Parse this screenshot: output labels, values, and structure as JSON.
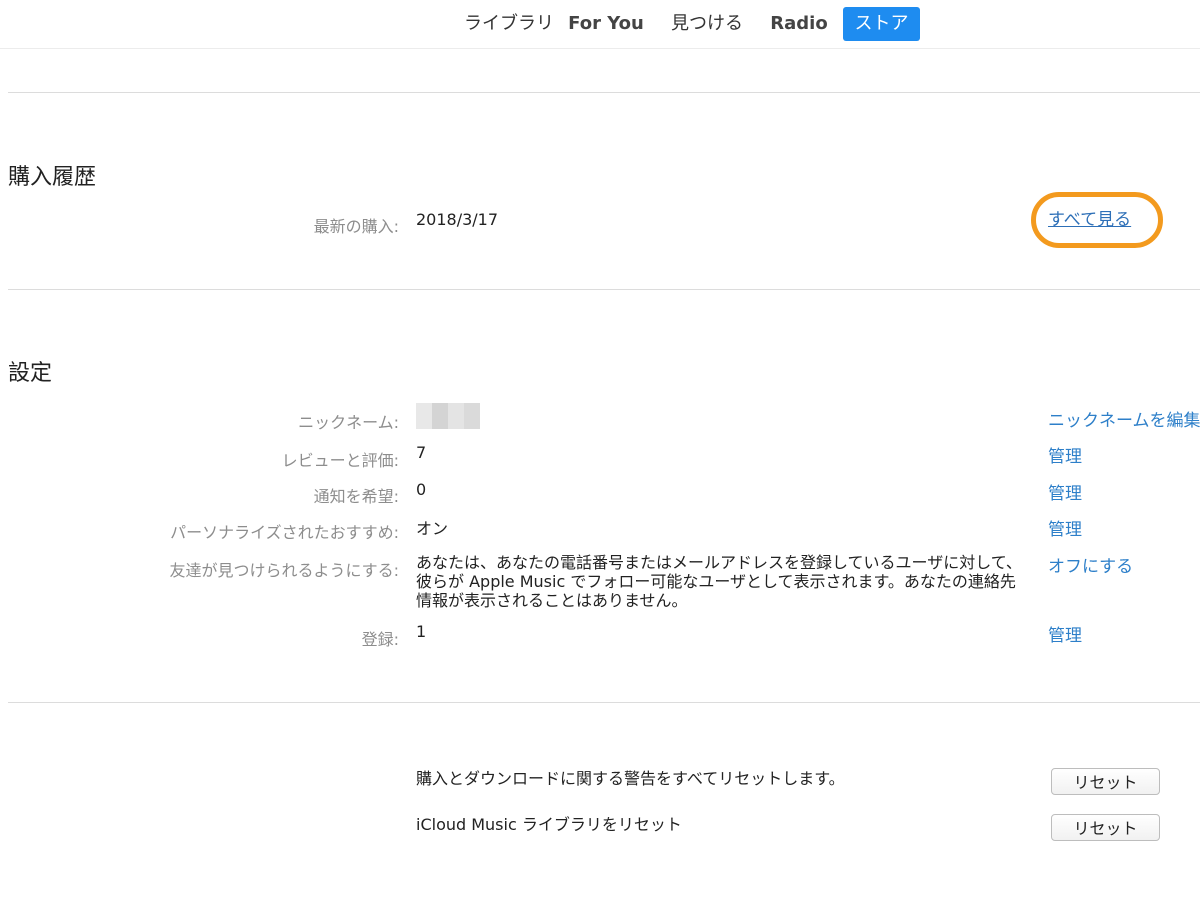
{
  "nav": {
    "tabs": [
      {
        "label": "ライブラリ",
        "selected": false
      },
      {
        "label": "For You",
        "selected": false
      },
      {
        "label": "見つける",
        "selected": false
      },
      {
        "label": "Radio",
        "selected": false
      },
      {
        "label": "ストア",
        "selected": true
      }
    ],
    "accent_color": "#1e8cf0"
  },
  "purchase_history": {
    "heading": "購入履歴",
    "latest_label": "最新の購入:",
    "latest_value": "2018/3/17",
    "see_all": "すべて見る",
    "highlight_color": "#f39a1e"
  },
  "settings": {
    "heading": "設定",
    "rows": [
      {
        "label": "ニックネーム:",
        "value": "",
        "action": "ニックネームを編集"
      },
      {
        "label": "レビューと評価:",
        "value": "7",
        "action": "管理"
      },
      {
        "label": "通知を希望:",
        "value": "0",
        "action": "管理"
      },
      {
        "label": "パーソナライズされたおすすめ:",
        "value": "オン",
        "action": "管理"
      },
      {
        "label": "友達が見つけられるようにする:",
        "value": "あなたは、あなたの電話番号またはメールアドレスを登録しているユーザに対して、彼らが Apple Music でフォロー可能なユーザとして表示されます。あなたの連絡先情報が表示されることはありません。",
        "action": "オフにする"
      },
      {
        "label": "登録:",
        "value": "1",
        "action": "管理"
      }
    ],
    "link_color": "#2d7fc9"
  },
  "reset": {
    "items": [
      {
        "text": "購入とダウンロードに関する警告をすべてリセットします。",
        "button": "リセット"
      },
      {
        "text": "iCloud Music ライブラリをリセット",
        "button": "リセット"
      }
    ]
  }
}
